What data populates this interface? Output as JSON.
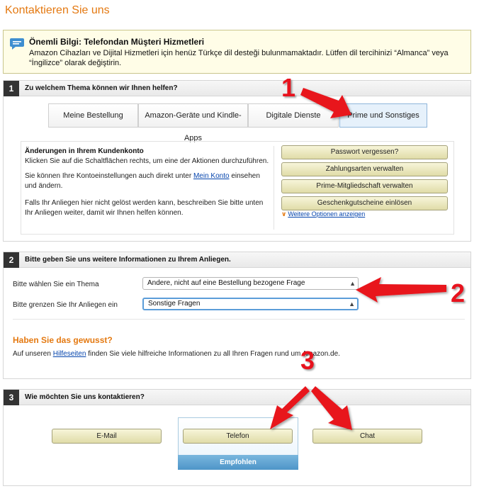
{
  "page": {
    "title": "Kontaktieren Sie uns"
  },
  "notice": {
    "title": "Önemli Bilgi: Telefondan Müşteri Hizmetleri",
    "body": "Amazon Cihazları ve Dijital Hizmetleri için henüz Türkçe dil desteği bulunmamaktadır. Lütfen dil tercihinizi “Almanca” veya “İngilizce” olarak değiştirin."
  },
  "step1": {
    "number": "1",
    "title": "Zu welchem Thema können wir Ihnen helfen?",
    "tabs": [
      {
        "label": "Meine Bestellung"
      },
      {
        "label": "Amazon-Geräte und Kindle-Apps"
      },
      {
        "label": "Digitale Dienste"
      },
      {
        "label": "Prime und Sonstiges"
      }
    ],
    "panel": {
      "heading": "Änderungen in Ihrem Kundenkonto",
      "text1": "Klicken Sie auf die Schaltflächen rechts, um eine der Aktionen durchzuführen.",
      "text2_before": "Sie können Ihre Kontoeinstellungen auch direkt unter ",
      "text2_link": "Mein Konto",
      "text2_after": " einsehen und ändern.",
      "text3": "Falls Ihr Anliegen hier nicht gelöst werden kann, beschreiben Sie bitte unten Ihr Anliegen weiter, damit wir Ihnen helfen können.",
      "actions": [
        {
          "label": "Passwort vergessen?"
        },
        {
          "label": "Zahlungsarten verwalten"
        },
        {
          "label": "Prime-Mitgliedschaft verwalten"
        },
        {
          "label": "Geschenkgutscheine einlösen"
        }
      ],
      "more_options": "Weitere Optionen anzeigen"
    }
  },
  "step2": {
    "number": "2",
    "title": "Bitte geben Sie uns weitere Informationen zu Ihrem Anliegen.",
    "topic_label": "Bitte wählen Sie ein Thema",
    "topic_value": "Andere, nicht auf eine Bestellung bezogene Frage",
    "narrow_label": "Bitte grenzen Sie Ihr Anliegen ein",
    "narrow_value": "Sonstige Fragen",
    "know_title": "Haben Sie das gewusst?",
    "know_before": "Auf unseren ",
    "know_link": "Hilfeseiten",
    "know_after": " finden Sie viele hilfreiche Informationen zu all Ihren Fragen rund um Amazon.de."
  },
  "step3": {
    "number": "3",
    "title": "Wie möchten Sie uns kontaktieren?",
    "email": "E-Mail",
    "phone": "Telefon",
    "chat": "Chat",
    "recommended": "Empfohlen"
  },
  "callouts": {
    "one": "1",
    "two": "2",
    "three": "3"
  },
  "colors": {
    "accent": "#e47911",
    "callout": "#e8121d",
    "link": "#0645ad"
  },
  "icons": {
    "notice": "speech-bubble-icon",
    "more": "chevron-down-icon",
    "select": "updown-arrow-icon"
  }
}
